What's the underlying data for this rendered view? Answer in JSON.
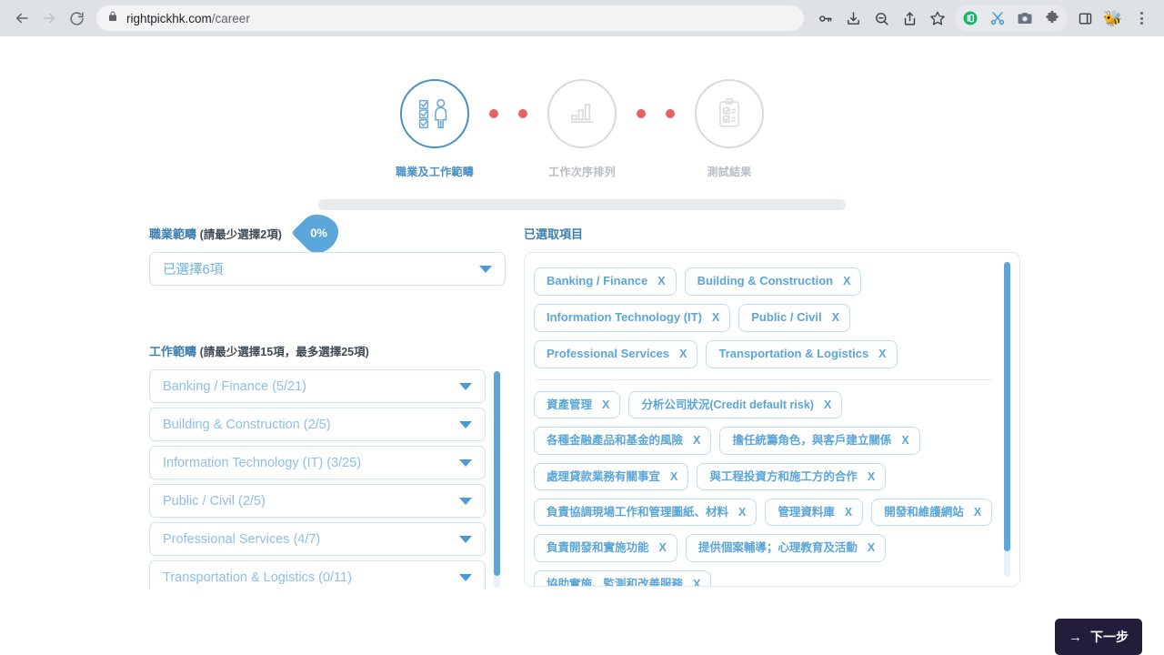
{
  "browser": {
    "url_domain": "rightpickhk.com",
    "url_path": "/career",
    "back_icon": "back-arrow-icon",
    "forward_icon": "forward-arrow-icon",
    "reload_icon": "reload-icon",
    "lock_icon": "lock-icon",
    "toolbar_icons": [
      "password-key-icon",
      "download-icon",
      "zoom-out-icon",
      "share-icon",
      "bookmark-star-icon"
    ],
    "extension_icons": [
      "pocket-extension-icon",
      "scissors-extension-icon",
      "camera-extension-icon",
      "puzzle-extensions-icon"
    ],
    "sidepanel_icon": "side-panel-icon",
    "profile_icon": "bee-avatar-icon",
    "menu_icon": "three-dot-menu-icon"
  },
  "stepper": {
    "steps": [
      {
        "label": "職業及工作範疇",
        "icon": "checklist-person-icon",
        "active": true
      },
      {
        "label": "工作次序排列",
        "icon": "bar-chart-icon",
        "active": false
      },
      {
        "label": "測試結果",
        "icon": "clipboard-checklist-icon",
        "active": false
      }
    ]
  },
  "progress": {
    "percent_label": "0%",
    "percent_value": 0,
    "track_color": "#e8eaec",
    "fill_color": "#5ba7dc"
  },
  "left": {
    "occupation": {
      "label": "職業範疇",
      "hint": "(請最少選擇2項)",
      "selected_value": "已選擇6項"
    },
    "job_scope": {
      "label": "工作範疇",
      "hint": "(請最少選擇15項，最多選擇25項)",
      "dropdowns": [
        "Banking / Finance (5/21)",
        "Building & Construction (2/5)",
        "Information Technology (IT) (3/25)",
        "Public / Civil (2/5)",
        "Professional Services (4/7)",
        "Transportation & Logistics (0/11)"
      ]
    }
  },
  "right": {
    "label": "已選取項目",
    "remove_symbol": "X",
    "category_chips": [
      "Banking / Finance",
      "Building & Construction",
      "Information Technology (IT)",
      "Public / Civil",
      "Professional Services",
      "Transportation & Logistics"
    ],
    "scope_chips": [
      "資產管理",
      "分析公司狀況(Credit default risk)",
      "各種金融產品和基金的風險",
      "擔任統籌角色，與客戶建立關係",
      "處理貸款業務有關事宜",
      "與工程投資方和施工方的合作",
      "負責協調現場工作和管理圖紙、材料",
      "管理資料庫",
      "開發和維護網站",
      "負責開發和實施功能",
      "提供個案輔導；心理教育及活動",
      "協助實施、監測和改善服務"
    ]
  },
  "footer": {
    "next_label": "下一步",
    "next_arrow": "→",
    "next_bg": "#231c3a"
  }
}
